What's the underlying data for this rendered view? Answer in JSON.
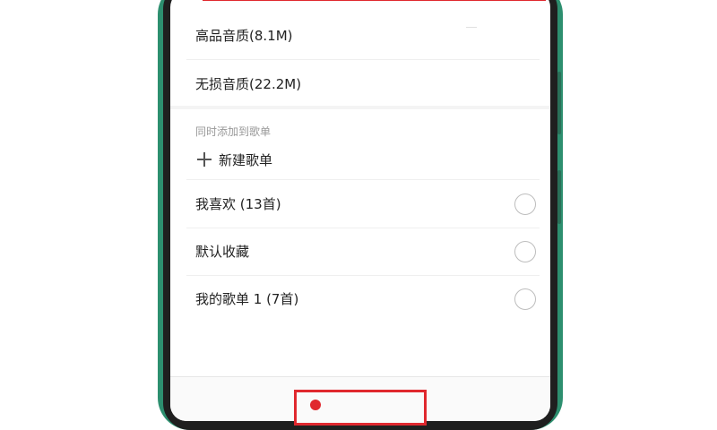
{
  "quality_options": [
    {
      "label": "高品音质(8.1M)"
    },
    {
      "label": "无损音质(22.2M)"
    }
  ],
  "add_to_playlist": {
    "section_label": "同时添加到歌单",
    "new_playlist_label": "新建歌单",
    "playlists": [
      {
        "label": "我喜欢 (13首)",
        "selected": false
      },
      {
        "label": "默认收藏",
        "selected": false
      },
      {
        "label": "我的歌单 1 (7首)",
        "selected": false
      }
    ]
  },
  "colors": {
    "highlight": "#e0282e",
    "phone_frame": "#2d8f6f"
  },
  "icons": {
    "new_playlist": "plus-icon",
    "playlist_select": "radio-circle",
    "confirm": "red-circle-icon"
  }
}
